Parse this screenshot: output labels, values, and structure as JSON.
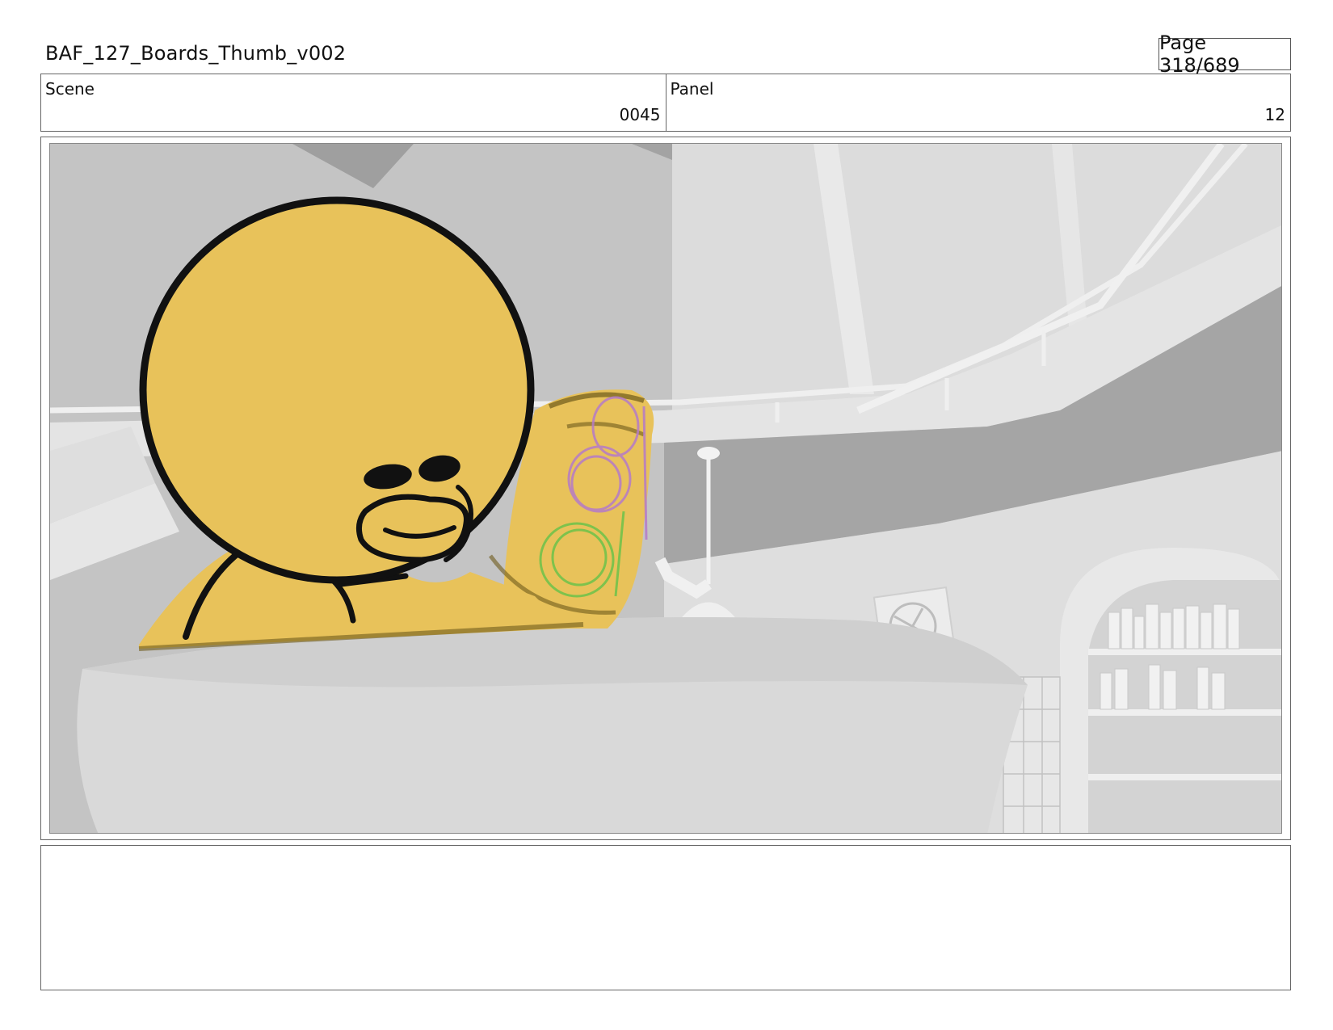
{
  "header": {
    "title": "BAF_127_Boards_Thumb_v002",
    "page": "Page 318/689"
  },
  "info": {
    "scene_label": "Scene",
    "scene_value": "0045",
    "panel_label": "Panel",
    "panel_value": "12"
  },
  "notes": {
    "text": ""
  },
  "colors": {
    "character_fill": "#E8C25A",
    "line": "#111111",
    "purple_sketch": "#B57BC8",
    "green_sketch": "#6CC34A"
  }
}
